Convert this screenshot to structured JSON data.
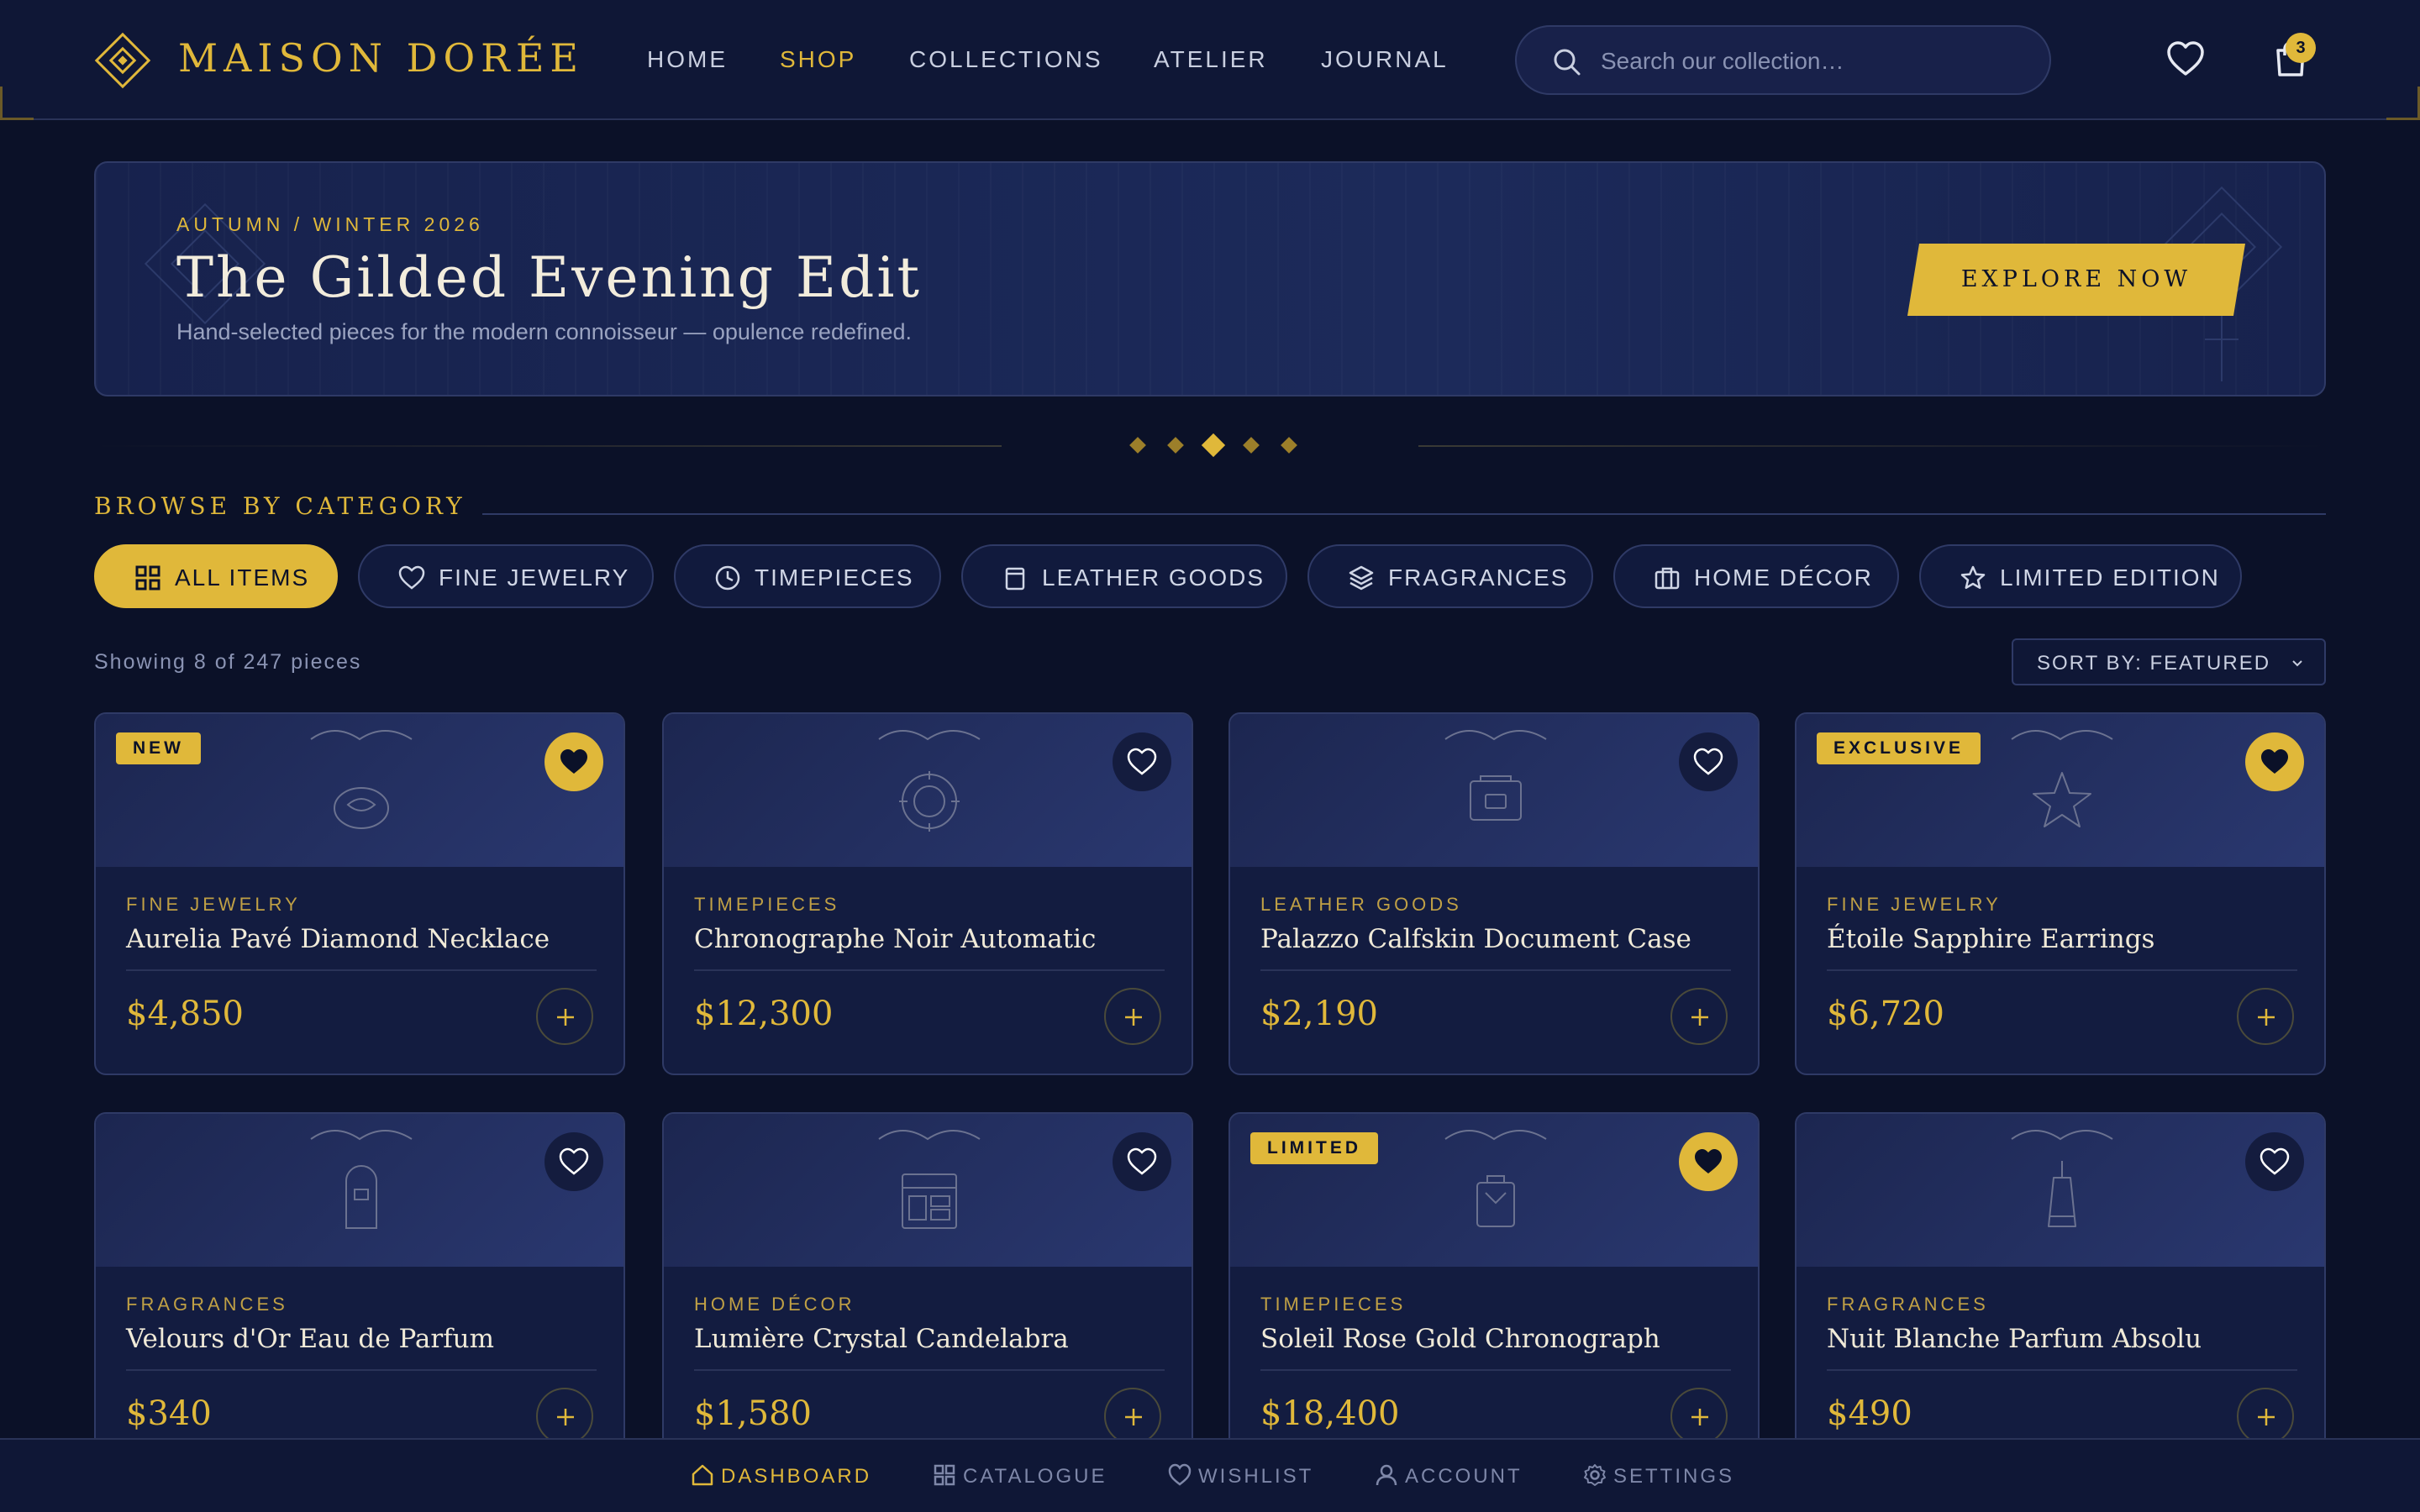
{
  "brand": {
    "name": "MAISON DORÉE"
  },
  "nav": {
    "items": [
      "HOME",
      "SHOP",
      "COLLECTIONS",
      "ATELIER",
      "JOURNAL"
    ],
    "active": "SHOP"
  },
  "search": {
    "placeholder": "Search our collection…"
  },
  "cart": {
    "count": "3"
  },
  "hero": {
    "eyebrow": "AUTUMN / WINTER 2026",
    "title": "The Gilded Evening Edit",
    "subtitle": "Hand-selected pieces for the modern connoisseur — opulence redefined.",
    "cta": "EXPLORE NOW",
    "slides": 5,
    "active_slide": 3
  },
  "categories": {
    "title": "BROWSE BY CATEGORY",
    "chips": [
      {
        "label": "ALL ITEMS",
        "icon": "grid-icon",
        "active": true
      },
      {
        "label": "FINE JEWELRY",
        "icon": "heart-icon",
        "active": false
      },
      {
        "label": "TIMEPIECES",
        "icon": "clock-icon",
        "active": false
      },
      {
        "label": "LEATHER GOODS",
        "icon": "bag-icon",
        "active": false
      },
      {
        "label": "FRAGRANCES",
        "icon": "layers-icon",
        "active": false
      },
      {
        "label": "HOME DÉCOR",
        "icon": "briefcase-icon",
        "active": false
      },
      {
        "label": "LIMITED EDITION",
        "icon": "star-icon",
        "active": false
      }
    ]
  },
  "listing": {
    "count_text": "Showing 8 of 247 pieces",
    "sort_label": "SORT BY: FEATURED"
  },
  "products": [
    {
      "category": "FINE JEWELRY",
      "name": "Aurelia Pavé Diamond Necklace",
      "price": "$4,850",
      "label": "NEW",
      "favorited": true,
      "icon": "necklace-icon"
    },
    {
      "category": "TIMEPIECES",
      "name": "Chronographe Noir Automatic",
      "price": "$12,300",
      "label": "",
      "favorited": false,
      "icon": "watch-icon"
    },
    {
      "category": "LEATHER GOODS",
      "name": "Palazzo Calfskin Document Case",
      "price": "$2,190",
      "label": "",
      "favorited": false,
      "icon": "case-icon"
    },
    {
      "category": "FINE JEWELRY",
      "name": "Étoile Sapphire Earrings",
      "price": "$6,720",
      "label": "EXCLUSIVE",
      "favorited": true,
      "icon": "star-icon"
    },
    {
      "category": "FRAGRANCES",
      "name": "Velours d'Or Eau de Parfum",
      "price": "$340",
      "label": "",
      "favorited": false,
      "icon": "perfume-icon"
    },
    {
      "category": "HOME DÉCOR",
      "name": "Lumière Crystal Candelabra",
      "price": "$1,580",
      "label": "",
      "favorited": false,
      "icon": "cabinet-icon"
    },
    {
      "category": "TIMEPIECES",
      "name": "Soleil Rose Gold Chronograph",
      "price": "$18,400",
      "label": "LIMITED",
      "favorited": true,
      "icon": "bottle-icon"
    },
    {
      "category": "FRAGRANCES",
      "name": "Nuit Blanche Parfum Absolu",
      "price": "$490",
      "label": "",
      "favorited": false,
      "icon": "vial-icon"
    }
  ],
  "bottom_nav": {
    "items": [
      {
        "label": "DASHBOARD",
        "icon": "home-icon",
        "active": true
      },
      {
        "label": "CATALOGUE",
        "icon": "grid-icon",
        "active": false
      },
      {
        "label": "WISHLIST",
        "icon": "heart-icon",
        "active": false
      },
      {
        "label": "ACCOUNT",
        "icon": "user-icon",
        "active": false
      },
      {
        "label": "SETTINGS",
        "icon": "gear-icon",
        "active": false
      }
    ]
  },
  "colors": {
    "accent": "#e0b83a",
    "background": "#0b1128",
    "panel": "#131c40",
    "border": "#2f3a66"
  }
}
